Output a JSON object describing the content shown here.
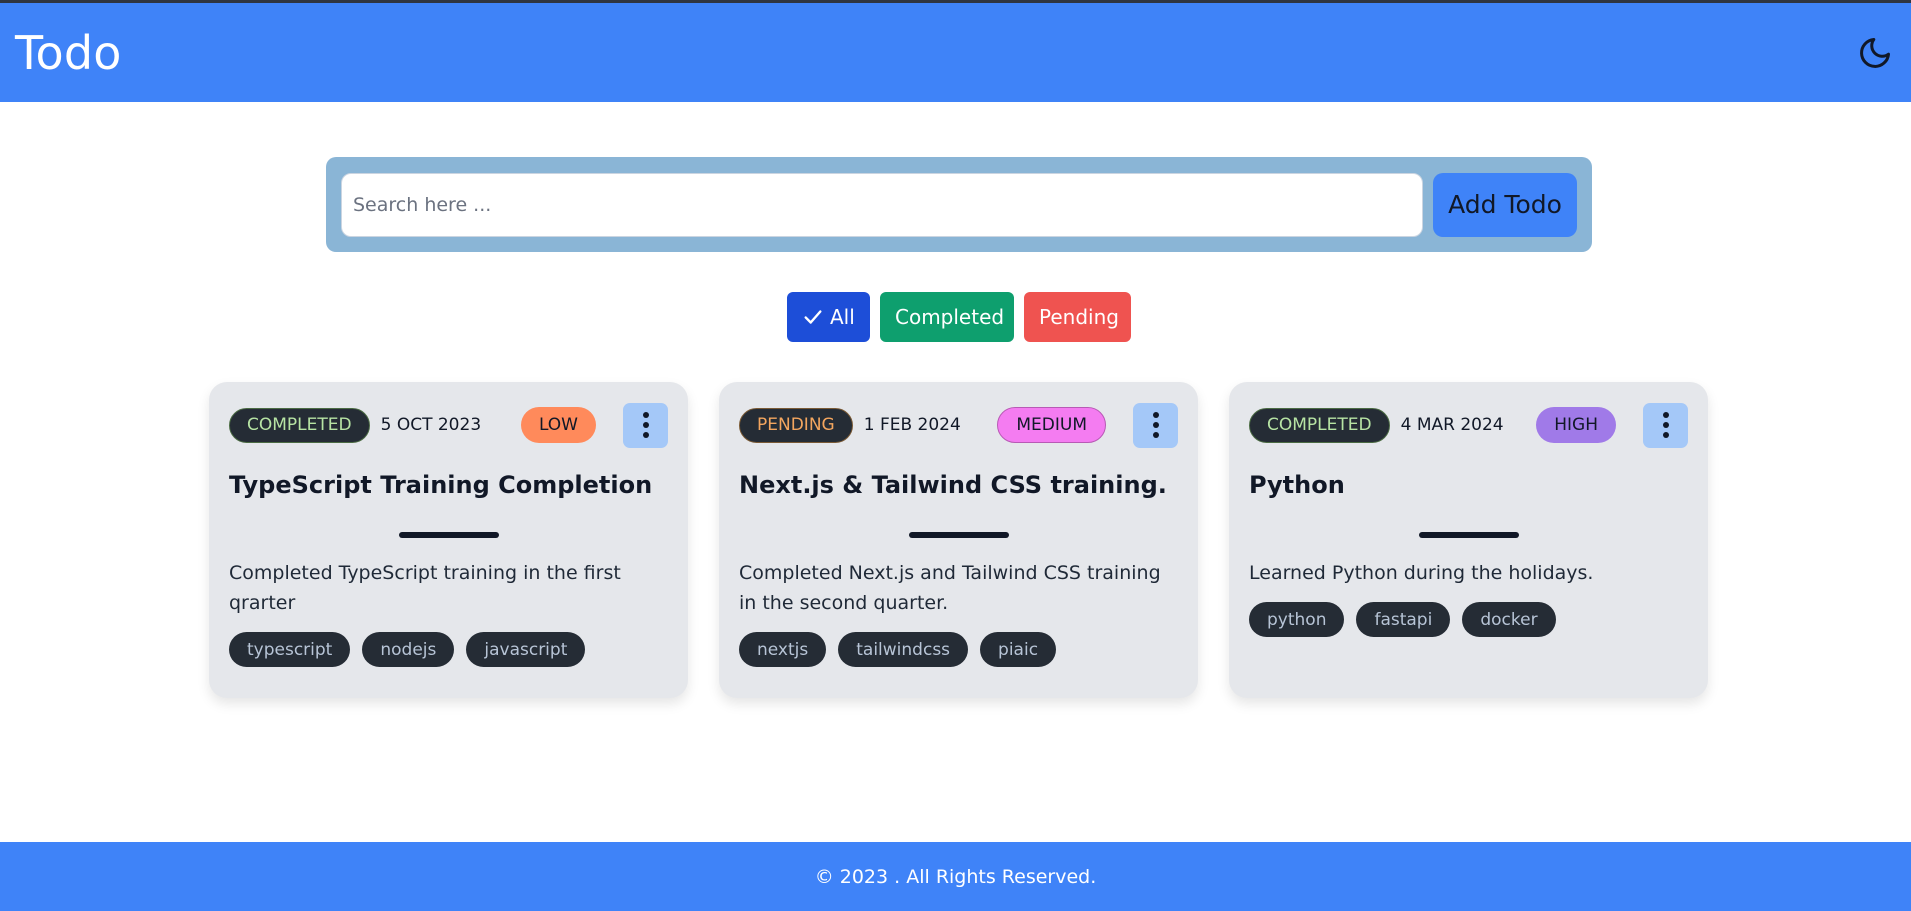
{
  "header": {
    "title": "Todo",
    "theme_icon": "moon-icon"
  },
  "search": {
    "placeholder": "Search here ...",
    "value": "",
    "add_label": "Add Todo"
  },
  "filters": {
    "all_label": "All",
    "all_icon": "check-icon",
    "completed_label": "Completed",
    "pending_label": "Pending",
    "selected": "All"
  },
  "todos": [
    {
      "status": "COMPLETED",
      "date": "5 OCT 2023",
      "priority": "LOW",
      "title": "TypeScript Training Completion",
      "description": "Completed TypeScript training in the first qrarter",
      "tags": [
        "typescript",
        "nodejs",
        "javascript"
      ]
    },
    {
      "status": "PENDING",
      "date": "1 FEB 2024",
      "priority": "MEDIUM",
      "title": "Next.js & Tailwind CSS training.",
      "description": "Completed Next.js and Tailwind CSS training in the second quarter.",
      "tags": [
        "nextjs",
        "tailwindcss",
        "piaic"
      ]
    },
    {
      "status": "COMPLETED",
      "date": "4 MAR 2024",
      "priority": "HIGH",
      "title": "Python",
      "description": "Learned Python during the holidays.",
      "tags": [
        "python",
        "fastapi",
        "docker"
      ]
    }
  ],
  "footer": {
    "text": "© 2023 . All Rights Reserved."
  },
  "colors": {
    "primary": "#3f83f8",
    "all_filter": "#1d4ed8",
    "completed_filter": "#0e9f6e",
    "pending_filter": "#ef5350",
    "low": "#ff8a5b",
    "medium": "#f47cf1",
    "high": "#a07ae8"
  }
}
